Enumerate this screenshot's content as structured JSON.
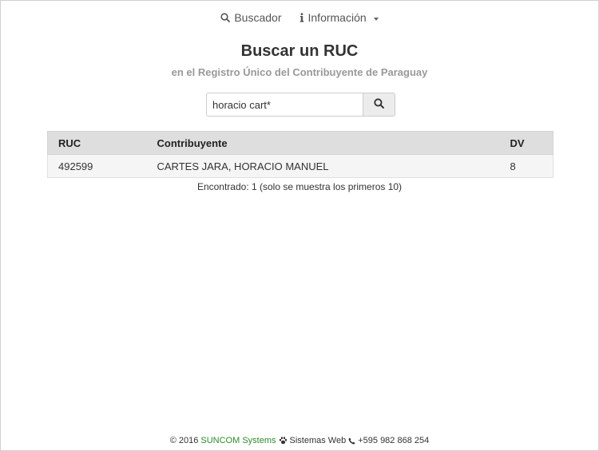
{
  "nav": {
    "search_label": "Buscador",
    "info_label": "Información",
    "search_icon": "search-icon",
    "info_icon": "info-icon"
  },
  "header": {
    "title": "Buscar un RUC",
    "subtitle": "en el Registro Único del Contribuyente de Paraguay"
  },
  "search": {
    "value": "horacio cart*",
    "button_icon": "search-icon"
  },
  "table": {
    "headers": [
      "RUC",
      "Contribuyente",
      "DV"
    ],
    "rows": [
      {
        "ruc": "492599",
        "contribuyente": "CARTES JARA, HORACIO MANUEL",
        "dv": "8"
      }
    ]
  },
  "result_info": "Encontrado: 1 (solo se muestra los primeros 10)",
  "footer": {
    "copyright": "© 2016",
    "company": "SUNCOM Systems",
    "tagline": "Sistemas Web",
    "phone": "+595 982 868 254",
    "link_color": "#2e8b2e"
  }
}
